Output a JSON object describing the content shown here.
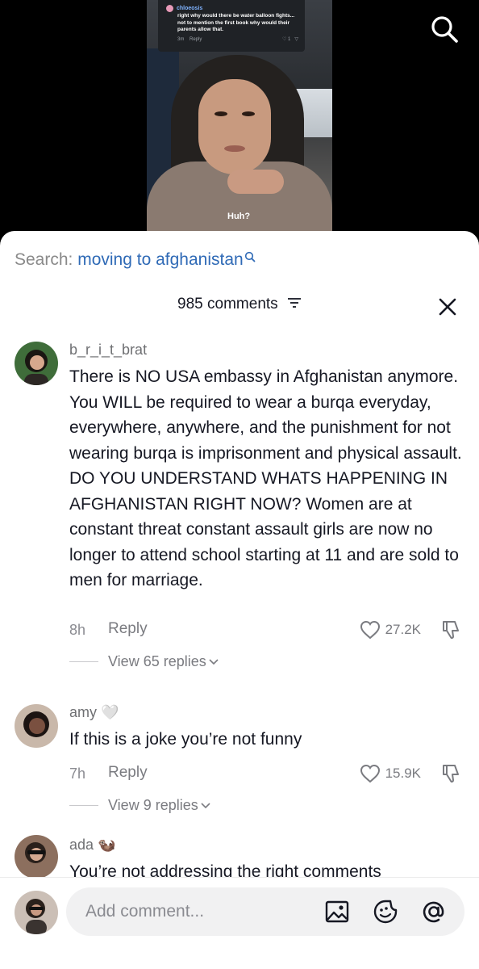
{
  "video": {
    "inset_comment": {
      "username": "chloeosis",
      "text": "right why would there be water balloon fights... not to mention the first book why would their parents allow that.",
      "time": "3m",
      "reply_label": "Reply",
      "likes": "1"
    },
    "caption": "Huh?",
    "search_icon": "search-icon"
  },
  "sheet": {
    "search_prefix": "Search:",
    "search_term": "moving to afghanistan",
    "comment_count": "985 comments",
    "filter_icon": "filter-icon",
    "close_icon": "close-icon"
  },
  "comments": [
    {
      "username": "b_r_i_t_brat",
      "text": "There is NO USA embassy in Afghanistan anymore. You WILL be required to wear a burqa everyday, everywhere, anywhere, and the punishment for not wearing burqa is imprisonment and physical assault. DO YOU UNDERSTAND WHATS HAPPENING IN AFGHANISTAN RIGHT NOW? Women are at constant threat constant assault girls are now no longer to attend school starting at 11 and are sold to men for marriage.",
      "time": "8h",
      "reply_label": "Reply",
      "likes": "27.2K",
      "view_replies": "View 65 replies"
    },
    {
      "username": "amy",
      "badge": "🤍",
      "text": "If this is a joke you’re not funny",
      "time": "7h",
      "reply_label": "Reply",
      "likes": "15.9K",
      "view_replies": "View 9 replies"
    },
    {
      "username": "ada",
      "badge": "🦦",
      "text": "You’re not addressing the right comments"
    }
  ],
  "composer": {
    "placeholder": "Add comment...",
    "icons": [
      "image-icon",
      "emoji-icon",
      "mention-icon"
    ]
  },
  "colors": {
    "link": "#2f6ab6",
    "text": "#161823",
    "muted": "#8a8b91",
    "inset_username": "#7fb3ff"
  }
}
